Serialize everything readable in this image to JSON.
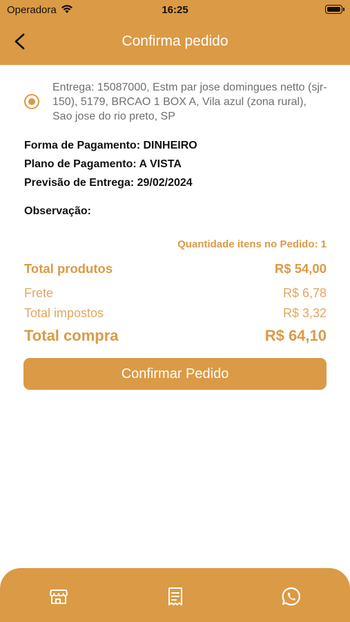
{
  "status_bar": {
    "carrier": "Operadora",
    "time": "16:25"
  },
  "header": {
    "title": "Confirma pedido"
  },
  "address": {
    "text": "Entrega: 15087000, Estm par jose domingues netto (sjr-150), 5179,  BRCAO 1 BOX A, Vila azul (zona rural),  Sao jose do rio preto, SP"
  },
  "info": {
    "payment_form": "Forma de Pagamento: DINHEIRO",
    "payment_plan": "Plano de Pagamento: A VISTA",
    "delivery_forecast": "Previsão de Entrega: 29/02/2024",
    "observation": "Observação:"
  },
  "summary": {
    "quantity": "Quantidade itens no Pedido: 1",
    "total_products_label": "Total produtos",
    "total_products_value": "R$ 54,00",
    "freight_label": "Frete",
    "freight_value": "R$ 6,78",
    "taxes_label": "Total impostos",
    "taxes_value": "R$ 3,32",
    "total_label": "Total compra",
    "total_value": "R$ 64,10"
  },
  "confirm_button": "Confirmar Pedido",
  "tabbar": {
    "icons": [
      "store-icon",
      "receipt-icon",
      "whatsapp-icon"
    ]
  },
  "colors": {
    "accent": "#DB9A45",
    "address_text": "#6f6f6f"
  }
}
